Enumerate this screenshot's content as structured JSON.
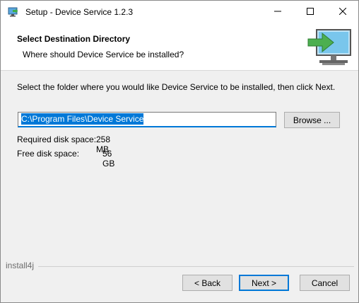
{
  "window": {
    "title": "Setup - Device Service 1.2.3"
  },
  "icons": {
    "app": "setup-app-icon",
    "minimize": "minimize-icon",
    "maximize": "maximize-icon",
    "close": "close-icon",
    "header": "computer-arrow-icon"
  },
  "header": {
    "title": "Select Destination Directory",
    "subtitle": "Where should Device Service be installed?"
  },
  "main": {
    "instruction": "Select the folder where you would like Device Service to be installed, then click Next.",
    "path_value": "C:\\Program Files\\Device Service",
    "browse_label": "Browse ...",
    "required_label": "Required disk space:",
    "required_value": "258 MB",
    "free_label": "Free disk space:",
    "free_value": "56 GB"
  },
  "footer": {
    "brand": "install4j",
    "back_label": "< Back",
    "next_label": "Next >",
    "cancel_label": "Cancel"
  },
  "colors": {
    "accent": "#0078d7",
    "header_bg": "#ffffff",
    "body_bg": "#f0f0f0",
    "arrow_green": "#4caf50"
  }
}
